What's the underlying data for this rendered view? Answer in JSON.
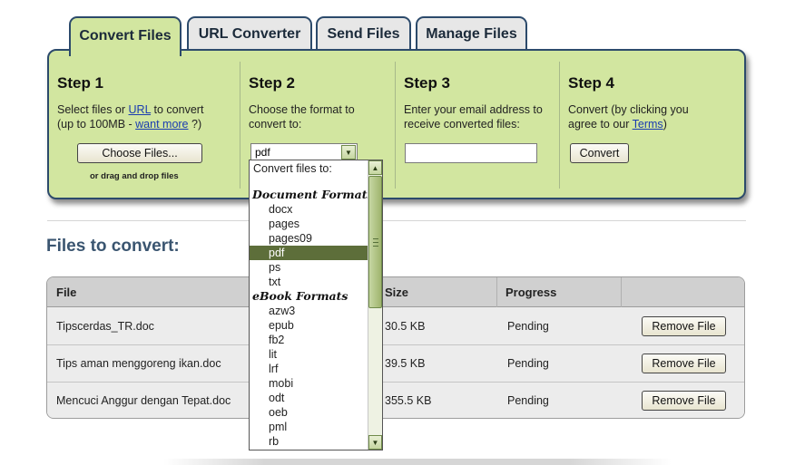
{
  "tabs": [
    {
      "label": "Convert Files",
      "active": true
    },
    {
      "label": "URL Converter",
      "active": false
    },
    {
      "label": "Send Files",
      "active": false
    },
    {
      "label": "Manage Files",
      "active": false
    }
  ],
  "steps": {
    "step1": {
      "title": "Step 1",
      "line1_pre": "Select files or ",
      "url_link": "URL",
      "line1_post": " to convert",
      "line2_pre": "(up to 100MB - ",
      "want_more_link": "want more",
      "line2_post": " ?)",
      "choose_button": "Choose Files...",
      "drag_text": "or drag and drop files"
    },
    "step2": {
      "title": "Step 2",
      "line1": "Choose the format to",
      "line2": "convert to:",
      "selected_format": "pdf"
    },
    "step3": {
      "title": "Step 3",
      "line1": "Enter your email address to",
      "line2": "receive converted files:",
      "email_value": ""
    },
    "step4": {
      "title": "Step 4",
      "line1": "Convert (by clicking you",
      "line2_pre": "agree to our ",
      "terms_link": "Terms",
      "line2_post": ")",
      "convert_button": "Convert"
    }
  },
  "dropdown": {
    "header": "Convert files to:",
    "groups": [
      {
        "label": "Document Formats",
        "items": [
          "docx",
          "pages",
          "pages09",
          "pdf",
          "ps",
          "txt"
        ]
      },
      {
        "label": "eBook Formats",
        "items": [
          "azw3",
          "epub",
          "fb2",
          "lit",
          "lrf",
          "mobi",
          "odt",
          "oeb",
          "pml",
          "rb"
        ]
      }
    ],
    "selected": "pdf",
    "scroll_up_icon": "▲",
    "scroll_down_icon": "▼"
  },
  "files_section": {
    "heading": "Files to convert:",
    "columns": [
      "File",
      "Size",
      "Progress",
      ""
    ],
    "rows": [
      {
        "file": "Tipscerdas_TR.doc",
        "size": "30.5 KB",
        "progress": "Pending",
        "action": "Remove File"
      },
      {
        "file": "Tips aman menggoreng ikan.doc",
        "size": "39.5 KB",
        "progress": "Pending",
        "action": "Remove File"
      },
      {
        "file": "Mencuci Anggur dengan Tepat.doc",
        "size": "355.5 KB",
        "progress": "Pending",
        "action": "Remove File"
      }
    ]
  },
  "colors": {
    "panel_green": "#d2e6a0",
    "border_navy": "#2c4a6b",
    "heading_blue": "#3a5570",
    "selected_option": "#5d6e3a",
    "link_blue": "#1a3cb0"
  }
}
